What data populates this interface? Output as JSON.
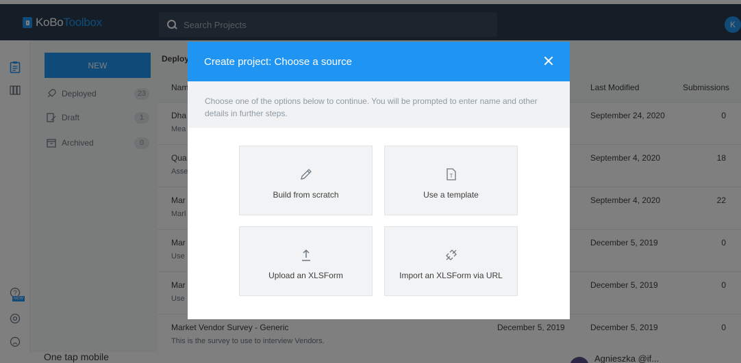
{
  "app": {
    "logo_main": "KoBo",
    "logo_accent": "Toolbox"
  },
  "search": {
    "placeholder": "Search Projects"
  },
  "user": {
    "initial": "K"
  },
  "nav_icons": [
    "clipboard-icon",
    "library-icon",
    "help-icon",
    "new-badge",
    "support-icon",
    "github-icon"
  ],
  "help_badge": "NEW",
  "sidebar": {
    "new_label": "NEW",
    "items": [
      {
        "label": "Deployed",
        "count": "23",
        "icon": "rocket-icon"
      },
      {
        "label": "Draft",
        "count": "1",
        "icon": "draft-icon"
      },
      {
        "label": "Archived",
        "count": "0",
        "icon": "archive-icon"
      }
    ]
  },
  "list": {
    "title": "Deploy",
    "columns": {
      "name": "Nam",
      "last_modified": "Last Modified",
      "submissions": "Submissions"
    },
    "rows": [
      {
        "name": "Dha",
        "desc": "Mea",
        "date": "",
        "last_modified": "September 24, 2020",
        "submissions": "0"
      },
      {
        "name": "Qua",
        "desc": "Asse",
        "date": "",
        "last_modified": "September 4, 2020",
        "submissions": "18"
      },
      {
        "name": "Mar",
        "desc": "Marl",
        "date": "",
        "last_modified": "September 4, 2020",
        "submissions": "22"
      },
      {
        "name": "Mar",
        "desc": "Use",
        "date": "",
        "last_modified": "December 5, 2019",
        "submissions": "0"
      },
      {
        "name": "Mar",
        "desc": "Use",
        "date": "",
        "last_modified": "December 5, 2019",
        "submissions": "0"
      },
      {
        "name": "Market Vendor Survey - Generic",
        "desc": "This is the survey to use to interview Vendors.",
        "date": "December 5, 2019",
        "last_modified": "December 5, 2019",
        "submissions": "0"
      }
    ]
  },
  "modal": {
    "title": "Create project: Choose a source",
    "info": "Choose one of the options below to continue. You will be prompted to enter name and other details in further steps.",
    "options": [
      {
        "label": "Build from scratch",
        "icon": "pencil-icon"
      },
      {
        "label": "Use a template",
        "icon": "template-icon"
      },
      {
        "label": "Upload an XLSForm",
        "icon": "upload-icon"
      },
      {
        "label": "Import an XLSForm via URL",
        "icon": "link-icon"
      }
    ]
  },
  "footer": {
    "left_text": "One tap mobile",
    "right_text": "Agnieszka @if..."
  }
}
